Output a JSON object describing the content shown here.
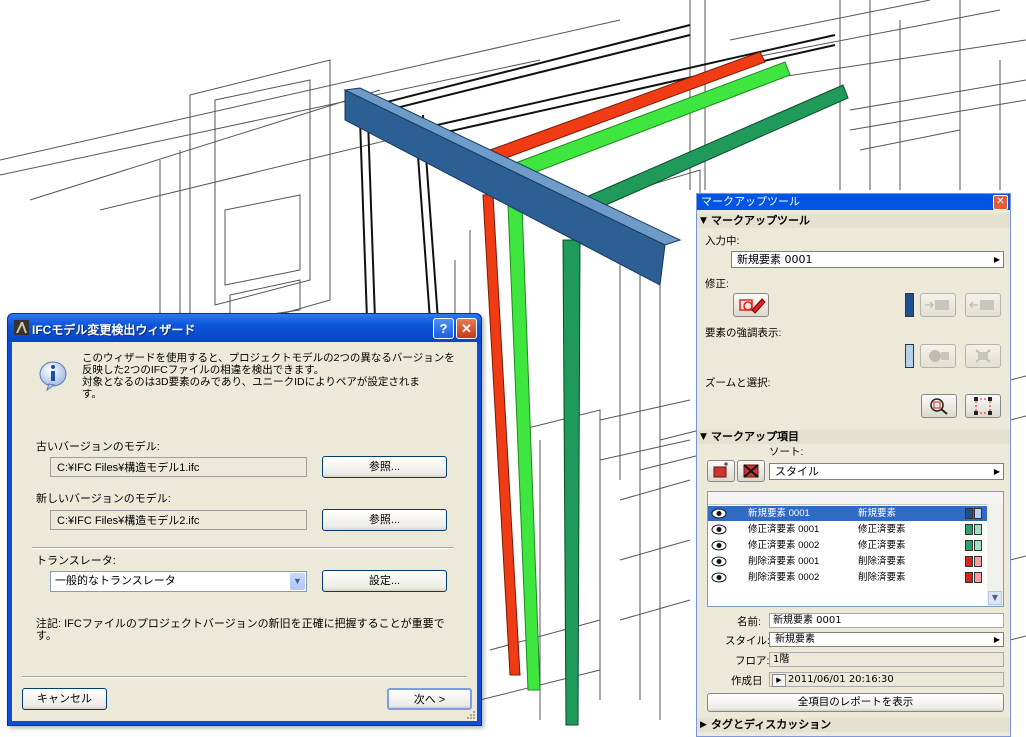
{
  "wizard": {
    "title": "IFCモデル変更検出ウィザード",
    "help_label": "?",
    "close_label": "✕",
    "description_line1": "このウィザードを使用すると、プロジェクトモデルの2つの異なるバージョンを",
    "description_line2": "反映した2つのIFCファイルの相違を検出できます。",
    "description_line3": "対象となるのは3D要素のみであり、ユニークIDによりペアが設定されま",
    "description_line4": "す。",
    "old_label": "古いバージョンのモデル:",
    "old_path": "C:¥IFC Files¥構造モデル1.ifc",
    "new_label": "新しいバージョンのモデル:",
    "new_path": "C:¥IFC Files¥構造モデル2.ifc",
    "browse_label": "参照...",
    "translator_label": "トランスレータ:",
    "translator_value": "一般的なトランスレータ",
    "settings_label": "設定...",
    "note_line1": "注記: IFCファイルのプロジェクトバージョンの新旧を正確に把握することが重要で",
    "note_line2": "す。",
    "cancel_label": "キャンセル",
    "next_label": "次へ >"
  },
  "markup": {
    "title": "マークアップツール",
    "close_label": "✕",
    "section1": "マークアップツール",
    "input_label": "入力中:",
    "input_value": "新規要素 0001",
    "modify_label": "修正:",
    "highlight_label": "要素の強調表示:",
    "zoom_label": "ズームと選択:",
    "section2": "マークアップ項目",
    "sort_label": "ソート:",
    "sort_value": "スタイル",
    "rows": [
      {
        "name": "新規要素 0001",
        "style": "新規要素",
        "color": "#1f4f8f",
        "selected": true
      },
      {
        "name": "修正済要素 0001",
        "style": "修正済要素",
        "color": "#22a86a",
        "selected": false
      },
      {
        "name": "修正済要素 0002",
        "style": "修正済要素",
        "color": "#22a86a",
        "selected": false
      },
      {
        "name": "削除済要素 0001",
        "style": "削除済要素",
        "color": "#e02020",
        "selected": false
      },
      {
        "name": "削除済要素 0002",
        "style": "削除済要素",
        "color": "#e02020",
        "selected": false
      }
    ],
    "name_label": "名前:",
    "name_value": "新規要素 0001",
    "style_label": "スタイル:",
    "style_value": "新規要素",
    "floor_label": "フロア:",
    "floor_value": "1階",
    "created_label": "作成日",
    "created_value": "2011/06/01 20:16:30",
    "report_label": "全項目のレポートを表示",
    "section3": "タグとディスカッション"
  },
  "colors": {
    "xp_blue": "#0a4fd6",
    "beam_blue": "#2c5f94",
    "red_column": "#f03c14",
    "green_column": "#3fe63f",
    "darkgreen_column": "#1f9a5a"
  }
}
